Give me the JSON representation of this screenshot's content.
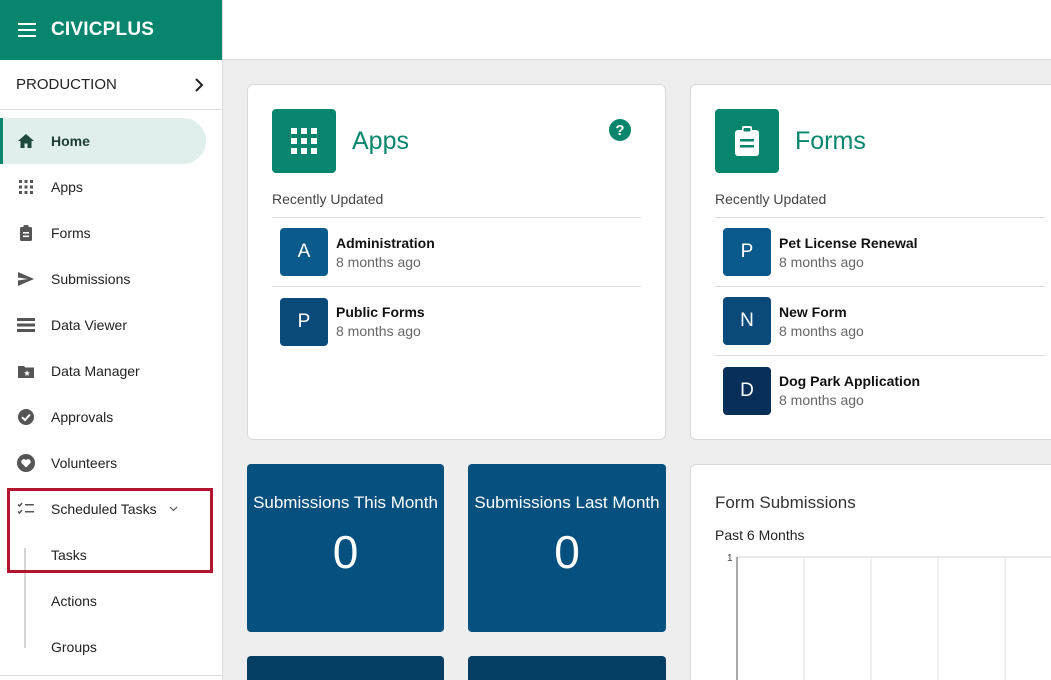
{
  "brand": {
    "title": "CIVICPLUS"
  },
  "environment": {
    "label": "PRODUCTION"
  },
  "nav": {
    "items": [
      {
        "label": "Home",
        "icon": "home-icon"
      },
      {
        "label": "Apps",
        "icon": "apps-grid-icon"
      },
      {
        "label": "Forms",
        "icon": "clipboard-icon"
      },
      {
        "label": "Submissions",
        "icon": "send-icon"
      },
      {
        "label": "Data Viewer",
        "icon": "list-view-icon"
      },
      {
        "label": "Data Manager",
        "icon": "folder-star-icon"
      },
      {
        "label": "Approvals",
        "icon": "check-circle-icon"
      },
      {
        "label": "Volunteers",
        "icon": "heart-hand-icon"
      },
      {
        "label": "Scheduled Tasks",
        "icon": "checklist-icon"
      }
    ],
    "sub_items": [
      {
        "label": "Tasks"
      },
      {
        "label": "Actions"
      },
      {
        "label": "Groups"
      }
    ]
  },
  "apps_card": {
    "title": "Apps",
    "recent_label": "Recently Updated",
    "items": [
      {
        "letter": "A",
        "name": "Administration",
        "time": "8 months ago",
        "color": "#0a5a8c"
      },
      {
        "letter": "P",
        "name": "Public Forms",
        "time": "8 months ago",
        "color": "#0a4a7a"
      }
    ]
  },
  "forms_card": {
    "title": "Forms",
    "recent_label": "Recently Updated",
    "items": [
      {
        "letter": "P",
        "name": "Pet License Renewal",
        "time": "8 months ago",
        "color": "#0a5a8c"
      },
      {
        "letter": "N",
        "name": "New Form",
        "time": "8 months ago",
        "color": "#0a4a7a"
      },
      {
        "letter": "D",
        "name": "Dog Park Application",
        "time": "8 months ago",
        "color": "#072f57"
      }
    ]
  },
  "stats": [
    {
      "title": "Submissions This Month",
      "value": "0"
    },
    {
      "title": "Submissions Last Month",
      "value": "0"
    }
  ],
  "chart_card": {
    "title": "Form Submissions",
    "subtitle": "Past 6 Months",
    "y_tick": "1"
  },
  "colors": {
    "brand": "#07866d",
    "stat": "#05507e",
    "highlight": "#b3142f"
  }
}
